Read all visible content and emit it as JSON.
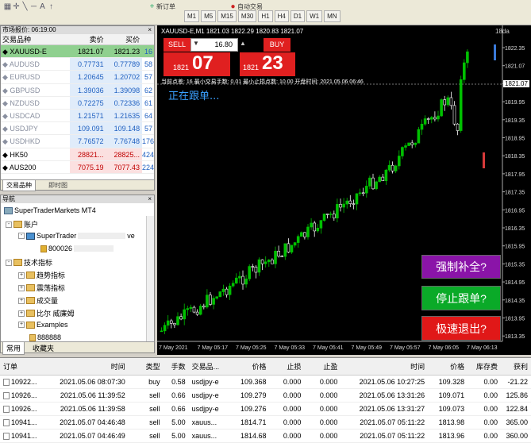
{
  "toolbar": {
    "labels": [
      "新订单",
      "自动交易"
    ],
    "timeframes": [
      "M1",
      "M5",
      "M15",
      "M30",
      "H1",
      "H4",
      "D1",
      "W1",
      "MN"
    ]
  },
  "market_watch": {
    "title": "市场报价: 06:19:00",
    "headers": [
      "交易品种",
      "卖价",
      "买价",
      ""
    ],
    "rows": [
      {
        "sym": "XAUUSD-E",
        "bid": "1821.07",
        "ask": "1821.23",
        "spread": "16",
        "sel": true
      },
      {
        "sym": "AUDUSD",
        "bid": "0.77731",
        "ask": "0.77789",
        "spread": "58",
        "dim": true
      },
      {
        "sym": "EURUSD",
        "bid": "1.20645",
        "ask": "1.20702",
        "spread": "57",
        "dim": true
      },
      {
        "sym": "GBPUSD",
        "bid": "1.39036",
        "ask": "1.39098",
        "spread": "62",
        "dim": true
      },
      {
        "sym": "NZDUSD",
        "bid": "0.72275",
        "ask": "0.72336",
        "spread": "61",
        "dim": true
      },
      {
        "sym": "USDCAD",
        "bid": "1.21571",
        "ask": "1.21635",
        "spread": "64",
        "dim": true
      },
      {
        "sym": "USDJPY",
        "bid": "109.091",
        "ask": "109.148",
        "spread": "57",
        "dim": true
      },
      {
        "sym": "USDHKD",
        "bid": "7.76572",
        "ask": "7.76748",
        "spread": "176",
        "dim": true
      },
      {
        "sym": "HK50",
        "bid": "28821...",
        "ask": "28825...",
        "spread": "424",
        "dim": false
      },
      {
        "sym": "AUS200",
        "bid": "7075.19",
        "ask": "7077.43",
        "spread": "224",
        "dim": false
      }
    ],
    "tabs": [
      "交易品种",
      "即时图"
    ]
  },
  "navigator": {
    "title": "导航",
    "items": [
      "SuperTraderMarkets MT4",
      "账户",
      "SuperTrader",
      "ve",
      "800026",
      "技术指标",
      "趋势指标",
      "震荡指标",
      "成交量",
      "比尔 威廉姆",
      "Examples",
      "888888"
    ],
    "tabs": [
      "常用",
      "收藏夹"
    ]
  },
  "chart": {
    "info": "XAUUSD-E,M1 1821.03 1822.29 1820.83 1821.07",
    "sell_label": "SELL",
    "buy_label": "BUY",
    "lot": "16.80",
    "sell_small": "1821",
    "sell_big": "07",
    "buy_small": "1821",
    "buy_big": "23",
    "stat": "当前点差: 16    最小交易手数: 0.01    最小止损点数: 10.00    开盘时间: 2021.05.06 06:46",
    "note": "正在跟单...",
    "cur_price": "1821.07",
    "badge": "18da",
    "prices": [
      "1822.35",
      "1821.07",
      "1820.35",
      "1819.95",
      "1819.35",
      "1818.95",
      "1818.35",
      "1817.95",
      "1817.35",
      "1816.95",
      "1816.35",
      "1815.95",
      "1815.35",
      "1814.95",
      "1814.35",
      "1813.95",
      "1813.35"
    ],
    "times": [
      "7 May 2021",
      "7 May 05:17",
      "7 May 05:25",
      "7 May 05:33",
      "7 May 05:41",
      "7 May 05:49",
      "7 May 05:57",
      "7 May 06:05",
      "7 May 06:13"
    ],
    "btn1": "强制补全?",
    "btn2": "停止跟单?",
    "btn3": "极速退出?",
    "colors": {
      "bull": "#00c000",
      "bear": "#ffffff",
      "btn1": "#8a14a8",
      "btn2": "#0aaa28",
      "btn3": "#e01818"
    }
  },
  "terminal": {
    "headers": [
      "订单",
      "时间",
      "类型",
      "手数",
      "交易品...",
      "价格",
      "止损",
      "止盈",
      "时间",
      "价格",
      "库存费",
      "获利"
    ],
    "rows": [
      [
        "10922...",
        "2021.05.06 08:07:30",
        "buy",
        "0.58",
        "usdjpy-e",
        "109.368",
        "0.000",
        "0.000",
        "2021.05.06 10:27:25",
        "109.328",
        "0.00",
        "-21.22"
      ],
      [
        "10926...",
        "2021.05.06 11:39:52",
        "sell",
        "0.66",
        "usdjpy-e",
        "109.279",
        "0.000",
        "0.000",
        "2021.05.06 13:31:26",
        "109.071",
        "0.00",
        "125.86"
      ],
      [
        "10926...",
        "2021.05.06 11:39:58",
        "sell",
        "0.66",
        "usdjpy-e",
        "109.276",
        "0.000",
        "0.000",
        "2021.05.06 13:31:27",
        "109.073",
        "0.00",
        "122.84"
      ],
      [
        "10941...",
        "2021.05.07 04:46:48",
        "sell",
        "5.00",
        "xauus...",
        "1814.71",
        "0.000",
        "0.000",
        "2021.05.07 05:11:22",
        "1813.98",
        "0.00",
        "365.00"
      ],
      [
        "10941...",
        "2021.05.07 04:46:49",
        "sell",
        "5.00",
        "xauus...",
        "1814.68",
        "0.000",
        "0.000",
        "2021.05.07 05:11:22",
        "1813.96",
        "0.00",
        "360.00"
      ]
    ]
  }
}
